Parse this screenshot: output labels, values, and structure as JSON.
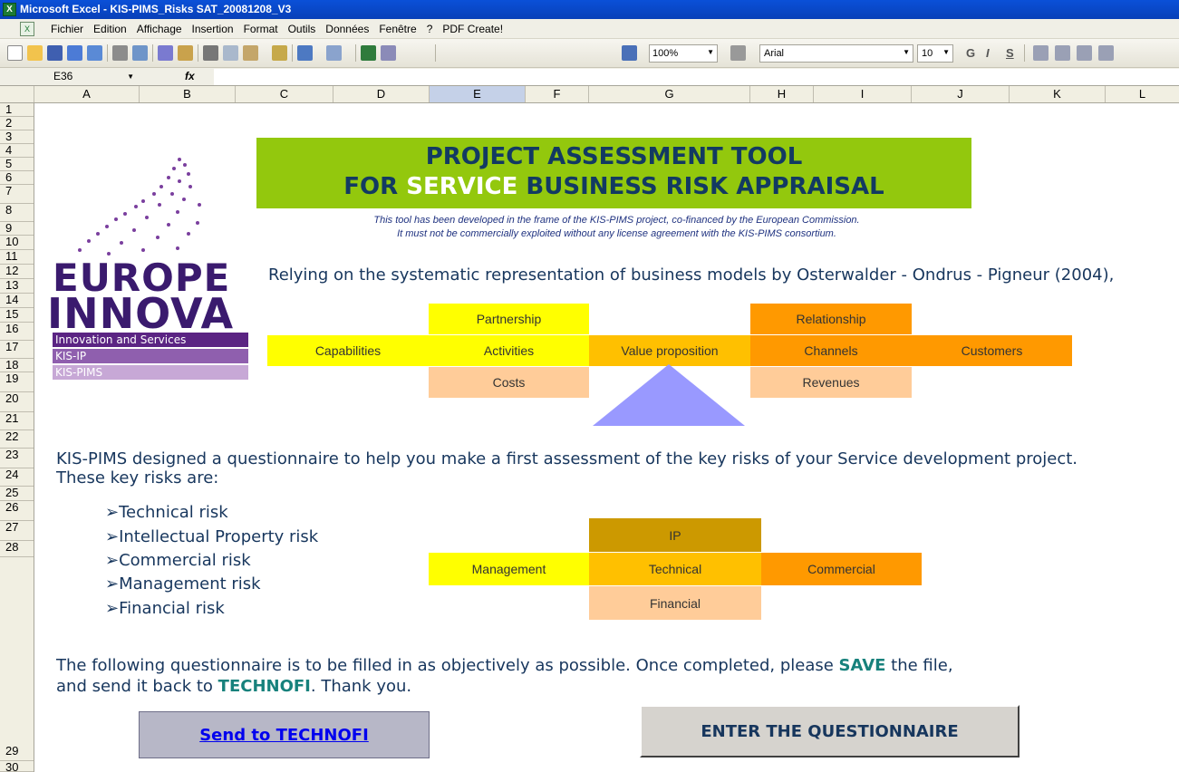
{
  "window": {
    "title": "Microsoft Excel - KIS-PIMS_Risks SAT_20081208_V3",
    "app_icon": "excel-icon"
  },
  "menu": [
    "Fichier",
    "Edition",
    "Affichage",
    "Insertion",
    "Format",
    "Outils",
    "Données",
    "Fenêtre",
    "?",
    "PDF Create!"
  ],
  "toolbar": {
    "zoom": "100%",
    "font": "Arial",
    "font_size": "10",
    "bold": "G",
    "italic": "I",
    "underline": "S"
  },
  "formula_bar": {
    "name_box": "E36",
    "fx_label": "fx",
    "value": ""
  },
  "columns": [
    "A",
    "B",
    "C",
    "D",
    "E",
    "F",
    "G",
    "H",
    "I",
    "J",
    "K",
    "L"
  ],
  "active_column": "E",
  "rows": [
    "1",
    "2",
    "3",
    "4",
    "5",
    "6",
    "7",
    "8",
    "9",
    "10",
    "11",
    "12",
    "13",
    "14",
    "15",
    "16",
    "17",
    "18",
    "19",
    "20",
    "21",
    "22",
    "23",
    "24",
    "25",
    "26",
    "27",
    "28",
    "29",
    "30"
  ],
  "logo": {
    "word1": "EUROPE",
    "word2": "INNOVA",
    "bar1": "Innovation and Services",
    "bar2": "KIS-IP",
    "bar3": "KIS-PIMS"
  },
  "banner": {
    "line1": "PROJECT ASSESSMENT TOOL",
    "line2_pre": "FOR ",
    "line2_hl": "SERVICE",
    "line2_post": " BUSINESS RISK APPRAISAL"
  },
  "disclaimer": {
    "line1": "This tool has been developed in the frame of the KIS-PIMS project, co-financed by the European Commission.",
    "line2": "It must not be commercially exploited without any license agreement with the KIS-PIMS consortium."
  },
  "relying_text": "Relying on the systematic representation of business models by Osterwalder - Ondrus - Pigneur (2004),",
  "business_model": {
    "partnership": "Partnership",
    "relationship": "Relationship",
    "capabilities": "Capabilities",
    "activities": "Activities",
    "value_proposition": "Value proposition",
    "channels": "Channels",
    "customers": "Customers",
    "costs": "Costs",
    "revenues": "Revenues"
  },
  "intro": {
    "line1": "KIS-PIMS designed a questionnaire to help you make a first assessment of the key risks of your Service development project.",
    "line2": "These key risks are:"
  },
  "risks": [
    "Technical risk",
    "Intellectual Property risk",
    "Commercial risk",
    "Management risk",
    "Financial risk"
  ],
  "risk_diagram": {
    "ip": "IP",
    "management": "Management",
    "technical": "Technical",
    "commercial": "Commercial",
    "financial": "Financial"
  },
  "closing": {
    "line1_pre": "The following questionnaire is to be filled in as objectively as possible. Once completed, please ",
    "line1_bold": "SAVE",
    "line1_post": " the file,",
    "line2_pre": "and send it back to ",
    "line2_bold": "TECHNOFI",
    "line2_post": ". Thank you."
  },
  "buttons": {
    "send": "Send to TECHNOFI",
    "enter": "ENTER THE QUESTIONNAIRE"
  },
  "colors": {
    "banner": "#93c80d",
    "banner_text": "#123a62",
    "yellow": "#ffff00",
    "gold": "#ffc000",
    "orange": "#ff9900",
    "peach": "#ffcc99",
    "brown": "#cc9900",
    "triangle": "#9999ff"
  }
}
